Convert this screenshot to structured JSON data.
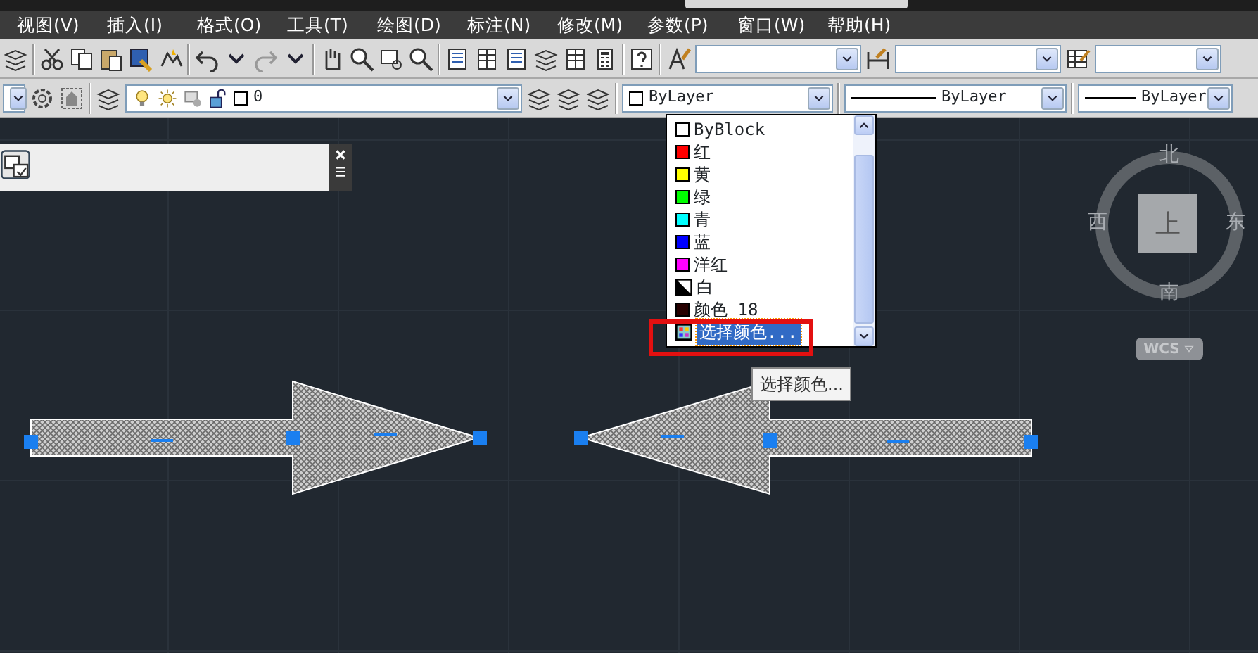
{
  "menu": [
    {
      "label": "视图(V)"
    },
    {
      "label": "插入(I)"
    },
    {
      "label": "格式(O)"
    },
    {
      "label": "工具(T)"
    },
    {
      "label": "绘图(D)"
    },
    {
      "label": "标注(N)"
    },
    {
      "label": "修改(M)"
    },
    {
      "label": "参数(P)"
    },
    {
      "label": "窗口(W)"
    },
    {
      "label": "帮助(H)"
    }
  ],
  "layer_combo": {
    "value": "0"
  },
  "color_combo": {
    "value": "ByLayer"
  },
  "linetype_combo": {
    "value": "ByLayer"
  },
  "lineweight_combo": {
    "value": "ByLayer"
  },
  "color_list": [
    {
      "label": "ByBlock",
      "kind": "swatch",
      "color": "#ffffff",
      "selected": false
    },
    {
      "label": "红",
      "kind": "swatch",
      "color": "#ff0000",
      "selected": false
    },
    {
      "label": "黄",
      "kind": "swatch",
      "color": "#ffff00",
      "selected": false
    },
    {
      "label": "绿",
      "kind": "swatch",
      "color": "#00ff00",
      "selected": false
    },
    {
      "label": "青",
      "kind": "swatch",
      "color": "#00ffff",
      "selected": false
    },
    {
      "label": "蓝",
      "kind": "swatch",
      "color": "#0000ff",
      "selected": false
    },
    {
      "label": "洋红",
      "kind": "swatch",
      "color": "#ff00ff",
      "selected": false
    },
    {
      "label": "白",
      "kind": "split",
      "color": "#000000",
      "selected": false
    },
    {
      "label": "颜色 18",
      "kind": "swatch",
      "color": "#260000",
      "selected": false
    },
    {
      "label": "选择颜色...",
      "kind": "picker",
      "selected": true
    }
  ],
  "tooltip": "选择颜色...",
  "viewcube": {
    "north": "北",
    "south": "南",
    "east": "东",
    "west": "西",
    "top": "上",
    "ucs": "WCS"
  }
}
